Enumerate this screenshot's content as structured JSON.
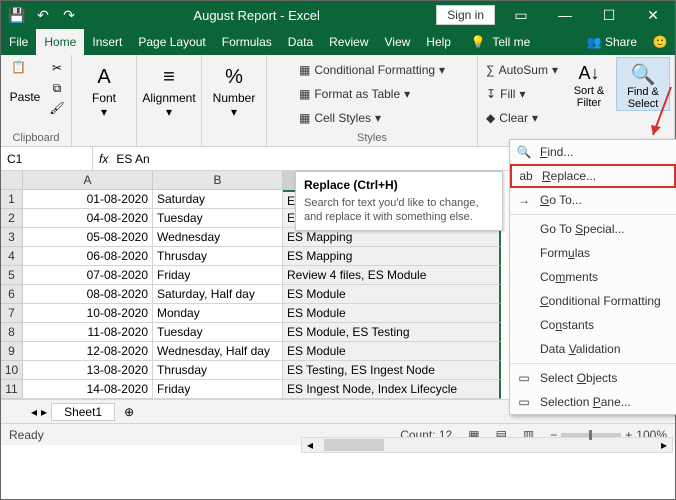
{
  "titlebar": {
    "title": "August Report  -  Excel",
    "signin": "Sign in"
  },
  "menu": {
    "tabs": [
      "File",
      "Home",
      "Insert",
      "Page Layout",
      "Formulas",
      "Data",
      "Review",
      "View",
      "Help"
    ],
    "active": "Home",
    "tellme": "Tell me",
    "share": "Share"
  },
  "ribbon": {
    "clipboard": {
      "label": "Clipboard",
      "paste": "Paste"
    },
    "font": {
      "label": "Font"
    },
    "alignment": {
      "label": "Alignment"
    },
    "number": {
      "label": "Number"
    },
    "styles": {
      "label": "Styles",
      "condfmt": "Conditional Formatting",
      "table": "Format as Table",
      "cellstyles": "Cell Styles"
    },
    "editing": {
      "autosum": "AutoSum",
      "fill": "Fill",
      "clear": "Clear",
      "sortfilter": "Sort & Filter",
      "findselect": "Find & Select"
    }
  },
  "namebox": "C1",
  "formula_preview": "ES An",
  "tooltip": {
    "title": "Replace (Ctrl+H)",
    "body": "Search for text you'd like to change, and replace it with something else."
  },
  "dropdown": {
    "items": [
      {
        "icon": "🔍",
        "label": "Find...",
        "u": "F"
      },
      {
        "icon": "ab",
        "label": "Replace...",
        "u": "R",
        "highlight": true
      },
      {
        "icon": "→",
        "label": "Go To...",
        "u": "G"
      },
      {
        "icon": "",
        "label": "Go To Special...",
        "u": "S"
      },
      {
        "icon": "",
        "label": "Formulas",
        "u": "u"
      },
      {
        "icon": "",
        "label": "Comments",
        "u": "m"
      },
      {
        "icon": "",
        "label": "Conditional Formatting",
        "u": "C"
      },
      {
        "icon": "",
        "label": "Constants",
        "u": "N"
      },
      {
        "icon": "",
        "label": "Data Validation",
        "u": "V"
      },
      {
        "icon": "▭",
        "label": "Select Objects",
        "u": "O"
      },
      {
        "icon": "▭",
        "label": "Selection Pane...",
        "u": "P"
      }
    ]
  },
  "columns": [
    "A",
    "B",
    "C"
  ],
  "rows": [
    {
      "n": 1,
      "a": "01-08-2020",
      "b": "Saturday",
      "c": "ES Analysis"
    },
    {
      "n": 2,
      "a": "04-08-2020",
      "b": "Tuesday",
      "c": "ES Analysis, ES Mapping"
    },
    {
      "n": 3,
      "a": "05-08-2020",
      "b": "Wednesday",
      "c": "ES Mapping"
    },
    {
      "n": 4,
      "a": "06-08-2020",
      "b": "Thrusday",
      "c": "ES Mapping"
    },
    {
      "n": 5,
      "a": "07-08-2020",
      "b": "Friday",
      "c": "Review 4 files, ES Module"
    },
    {
      "n": 6,
      "a": "08-08-2020",
      "b": "Saturday, Half day",
      "c": "ES Module"
    },
    {
      "n": 7,
      "a": "10-08-2020",
      "b": "Monday",
      "c": "ES Module"
    },
    {
      "n": 8,
      "a": "11-08-2020",
      "b": "Tuesday",
      "c": "ES Module, ES Testing"
    },
    {
      "n": 9,
      "a": "12-08-2020",
      "b": "Wednesday, Half day",
      "c": "ES Module"
    },
    {
      "n": 10,
      "a": "13-08-2020",
      "b": "Thrusday",
      "c": "ES Testing, ES Ingest Node"
    },
    {
      "n": 11,
      "a": "14-08-2020",
      "b": "Friday",
      "c": "ES Ingest Node, Index Lifecycle"
    }
  ],
  "sheet": {
    "name": "Sheet1"
  },
  "status": {
    "ready": "Ready",
    "count": "Count: 12",
    "zoom": "100%"
  }
}
